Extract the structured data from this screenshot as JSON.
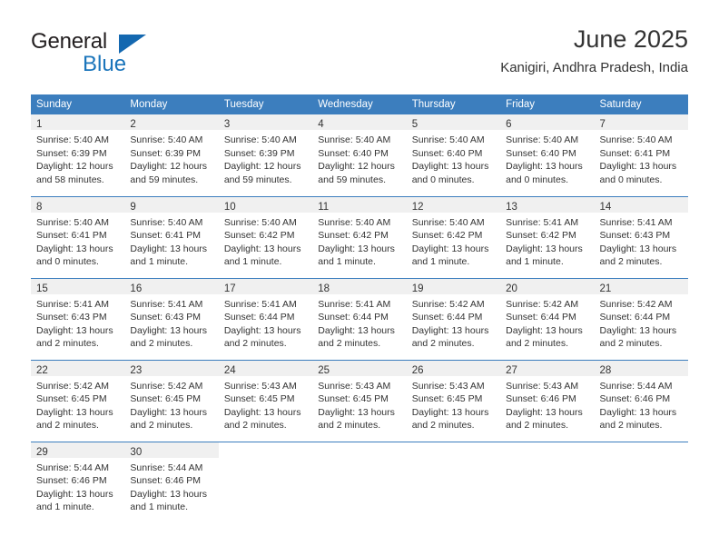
{
  "logo": {
    "word1": "General",
    "word2": "Blue",
    "triangle_color": "#1468b0",
    "blue_color": "#1b75bb"
  },
  "header": {
    "title": "June 2025",
    "subtitle": "Kanigiri, Andhra Pradesh, India"
  },
  "theme": {
    "header_blue": "#3c7ebe",
    "daynum_band": "#f0f0f0",
    "text": "#333333"
  },
  "calendar": {
    "weekday_headers": [
      "Sunday",
      "Monday",
      "Tuesday",
      "Wednesday",
      "Thursday",
      "Friday",
      "Saturday"
    ],
    "weeks": [
      [
        {
          "day": "1",
          "sunrise": "Sunrise: 5:40 AM",
          "sunset": "Sunset: 6:39 PM",
          "daylight": "Daylight: 12 hours and 58 minutes."
        },
        {
          "day": "2",
          "sunrise": "Sunrise: 5:40 AM",
          "sunset": "Sunset: 6:39 PM",
          "daylight": "Daylight: 12 hours and 59 minutes."
        },
        {
          "day": "3",
          "sunrise": "Sunrise: 5:40 AM",
          "sunset": "Sunset: 6:39 PM",
          "daylight": "Daylight: 12 hours and 59 minutes."
        },
        {
          "day": "4",
          "sunrise": "Sunrise: 5:40 AM",
          "sunset": "Sunset: 6:40 PM",
          "daylight": "Daylight: 12 hours and 59 minutes."
        },
        {
          "day": "5",
          "sunrise": "Sunrise: 5:40 AM",
          "sunset": "Sunset: 6:40 PM",
          "daylight": "Daylight: 13 hours and 0 minutes."
        },
        {
          "day": "6",
          "sunrise": "Sunrise: 5:40 AM",
          "sunset": "Sunset: 6:40 PM",
          "daylight": "Daylight: 13 hours and 0 minutes."
        },
        {
          "day": "7",
          "sunrise": "Sunrise: 5:40 AM",
          "sunset": "Sunset: 6:41 PM",
          "daylight": "Daylight: 13 hours and 0 minutes."
        }
      ],
      [
        {
          "day": "8",
          "sunrise": "Sunrise: 5:40 AM",
          "sunset": "Sunset: 6:41 PM",
          "daylight": "Daylight: 13 hours and 0 minutes."
        },
        {
          "day": "9",
          "sunrise": "Sunrise: 5:40 AM",
          "sunset": "Sunset: 6:41 PM",
          "daylight": "Daylight: 13 hours and 1 minute."
        },
        {
          "day": "10",
          "sunrise": "Sunrise: 5:40 AM",
          "sunset": "Sunset: 6:42 PM",
          "daylight": "Daylight: 13 hours and 1 minute."
        },
        {
          "day": "11",
          "sunrise": "Sunrise: 5:40 AM",
          "sunset": "Sunset: 6:42 PM",
          "daylight": "Daylight: 13 hours and 1 minute."
        },
        {
          "day": "12",
          "sunrise": "Sunrise: 5:40 AM",
          "sunset": "Sunset: 6:42 PM",
          "daylight": "Daylight: 13 hours and 1 minute."
        },
        {
          "day": "13",
          "sunrise": "Sunrise: 5:41 AM",
          "sunset": "Sunset: 6:42 PM",
          "daylight": "Daylight: 13 hours and 1 minute."
        },
        {
          "day": "14",
          "sunrise": "Sunrise: 5:41 AM",
          "sunset": "Sunset: 6:43 PM",
          "daylight": "Daylight: 13 hours and 2 minutes."
        }
      ],
      [
        {
          "day": "15",
          "sunrise": "Sunrise: 5:41 AM",
          "sunset": "Sunset: 6:43 PM",
          "daylight": "Daylight: 13 hours and 2 minutes."
        },
        {
          "day": "16",
          "sunrise": "Sunrise: 5:41 AM",
          "sunset": "Sunset: 6:43 PM",
          "daylight": "Daylight: 13 hours and 2 minutes."
        },
        {
          "day": "17",
          "sunrise": "Sunrise: 5:41 AM",
          "sunset": "Sunset: 6:44 PM",
          "daylight": "Daylight: 13 hours and 2 minutes."
        },
        {
          "day": "18",
          "sunrise": "Sunrise: 5:41 AM",
          "sunset": "Sunset: 6:44 PM",
          "daylight": "Daylight: 13 hours and 2 minutes."
        },
        {
          "day": "19",
          "sunrise": "Sunrise: 5:42 AM",
          "sunset": "Sunset: 6:44 PM",
          "daylight": "Daylight: 13 hours and 2 minutes."
        },
        {
          "day": "20",
          "sunrise": "Sunrise: 5:42 AM",
          "sunset": "Sunset: 6:44 PM",
          "daylight": "Daylight: 13 hours and 2 minutes."
        },
        {
          "day": "21",
          "sunrise": "Sunrise: 5:42 AM",
          "sunset": "Sunset: 6:44 PM",
          "daylight": "Daylight: 13 hours and 2 minutes."
        }
      ],
      [
        {
          "day": "22",
          "sunrise": "Sunrise: 5:42 AM",
          "sunset": "Sunset: 6:45 PM",
          "daylight": "Daylight: 13 hours and 2 minutes."
        },
        {
          "day": "23",
          "sunrise": "Sunrise: 5:42 AM",
          "sunset": "Sunset: 6:45 PM",
          "daylight": "Daylight: 13 hours and 2 minutes."
        },
        {
          "day": "24",
          "sunrise": "Sunrise: 5:43 AM",
          "sunset": "Sunset: 6:45 PM",
          "daylight": "Daylight: 13 hours and 2 minutes."
        },
        {
          "day": "25",
          "sunrise": "Sunrise: 5:43 AM",
          "sunset": "Sunset: 6:45 PM",
          "daylight": "Daylight: 13 hours and 2 minutes."
        },
        {
          "day": "26",
          "sunrise": "Sunrise: 5:43 AM",
          "sunset": "Sunset: 6:45 PM",
          "daylight": "Daylight: 13 hours and 2 minutes."
        },
        {
          "day": "27",
          "sunrise": "Sunrise: 5:43 AM",
          "sunset": "Sunset: 6:46 PM",
          "daylight": "Daylight: 13 hours and 2 minutes."
        },
        {
          "day": "28",
          "sunrise": "Sunrise: 5:44 AM",
          "sunset": "Sunset: 6:46 PM",
          "daylight": "Daylight: 13 hours and 2 minutes."
        }
      ],
      [
        {
          "day": "29",
          "sunrise": "Sunrise: 5:44 AM",
          "sunset": "Sunset: 6:46 PM",
          "daylight": "Daylight: 13 hours and 1 minute."
        },
        {
          "day": "30",
          "sunrise": "Sunrise: 5:44 AM",
          "sunset": "Sunset: 6:46 PM",
          "daylight": "Daylight: 13 hours and 1 minute."
        },
        {
          "day": "",
          "sunrise": "",
          "sunset": "",
          "daylight": ""
        },
        {
          "day": "",
          "sunrise": "",
          "sunset": "",
          "daylight": ""
        },
        {
          "day": "",
          "sunrise": "",
          "sunset": "",
          "daylight": ""
        },
        {
          "day": "",
          "sunrise": "",
          "sunset": "",
          "daylight": ""
        },
        {
          "day": "",
          "sunrise": "",
          "sunset": "",
          "daylight": ""
        }
      ]
    ]
  }
}
